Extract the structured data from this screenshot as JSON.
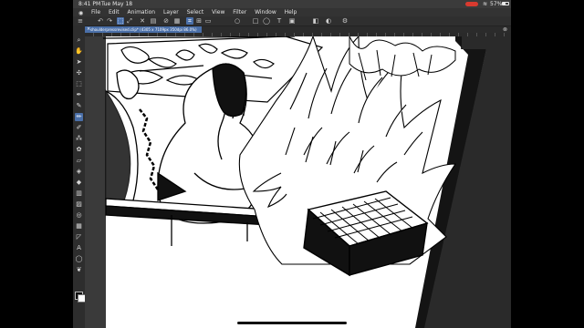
{
  "statusbar": {
    "time": "8:41 PM",
    "date": "Tue May 18",
    "battery": "57%",
    "recording_color": "#d83a2f"
  },
  "menubar": {
    "items": [
      "File",
      "Edit",
      "Animation",
      "Layer",
      "Select",
      "View",
      "Filter",
      "Window",
      "Help"
    ]
  },
  "toolbar": {
    "icons": [
      "menu-icon",
      "undo-icon",
      "redo-icon",
      "select-icon",
      "transform-icon",
      "clear-icon",
      "fill-icon",
      "lasso-icon",
      "ruler-icon",
      "snap-icon",
      "grid-icon",
      "circle-icon",
      "rect-icon",
      "ellipse-icon",
      "text-icon",
      "image-icon",
      "settings-icon"
    ]
  },
  "document_tab": {
    "name": "shoulderpressrevised.clip* (4305 x 7109px 350dpi 86.0%)"
  },
  "left_tools": [
    "zoom-icon",
    "move-icon",
    "operation-icon",
    "lasso-icon",
    "select-icon",
    "eyedropper-icon",
    "pen-icon",
    "pencil-icon",
    "brush-icon",
    "airbrush-icon",
    "decoration-icon",
    "eraser-icon",
    "blend-icon",
    "fill-icon",
    "gradient-icon",
    "figure-icon",
    "frame-icon",
    "ruler-icon",
    "text-icon",
    "balloon-icon",
    "correct-line-icon",
    "color-icon"
  ],
  "accent_color": "#4a6fa8"
}
